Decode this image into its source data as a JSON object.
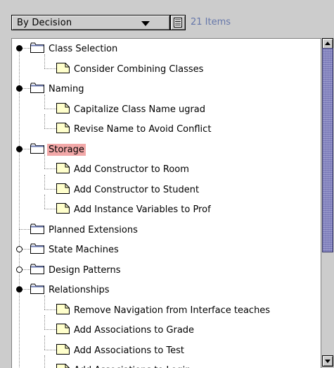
{
  "toolbar": {
    "perspective_label": "By Decision",
    "item_count": "21 Items"
  },
  "tree": {
    "rows": [
      {
        "label": "Class Selection",
        "type": "folder",
        "handle": "filled"
      },
      {
        "label": "Consider Combining Classes",
        "type": "note"
      },
      {
        "label": "Naming",
        "type": "folder",
        "handle": "filled"
      },
      {
        "label": "Capitalize Class Name ugrad",
        "type": "note"
      },
      {
        "label": "Revise Name to Avoid Conflict",
        "type": "note"
      },
      {
        "label": "Storage",
        "type": "folder",
        "handle": "filled",
        "selected": true
      },
      {
        "label": "Add Constructor to Room",
        "type": "note"
      },
      {
        "label": "Add Constructor to Student",
        "type": "note"
      },
      {
        "label": "Add Instance Variables to Prof",
        "type": "note"
      },
      {
        "label": "Planned Extensions",
        "type": "folder",
        "handle": "none"
      },
      {
        "label": "State Machines",
        "type": "folder",
        "handle": "open"
      },
      {
        "label": "Design Patterns",
        "type": "folder",
        "handle": "open"
      },
      {
        "label": "Relationships",
        "type": "folder",
        "handle": "filled"
      },
      {
        "label": "Remove Navigation from Interface teaches",
        "type": "note"
      },
      {
        "label": "Add Associations to Grade",
        "type": "note"
      },
      {
        "label": "Add Associations to Test",
        "type": "note"
      },
      {
        "label": "Add Associations to Login",
        "type": "note"
      }
    ]
  },
  "colors": {
    "selection": "#f2a8a8",
    "count_text": "#6677aa",
    "scroll_thumb": "#9999cc",
    "folder_fill": "#ffffff",
    "note_fill": "#ffffcc"
  }
}
